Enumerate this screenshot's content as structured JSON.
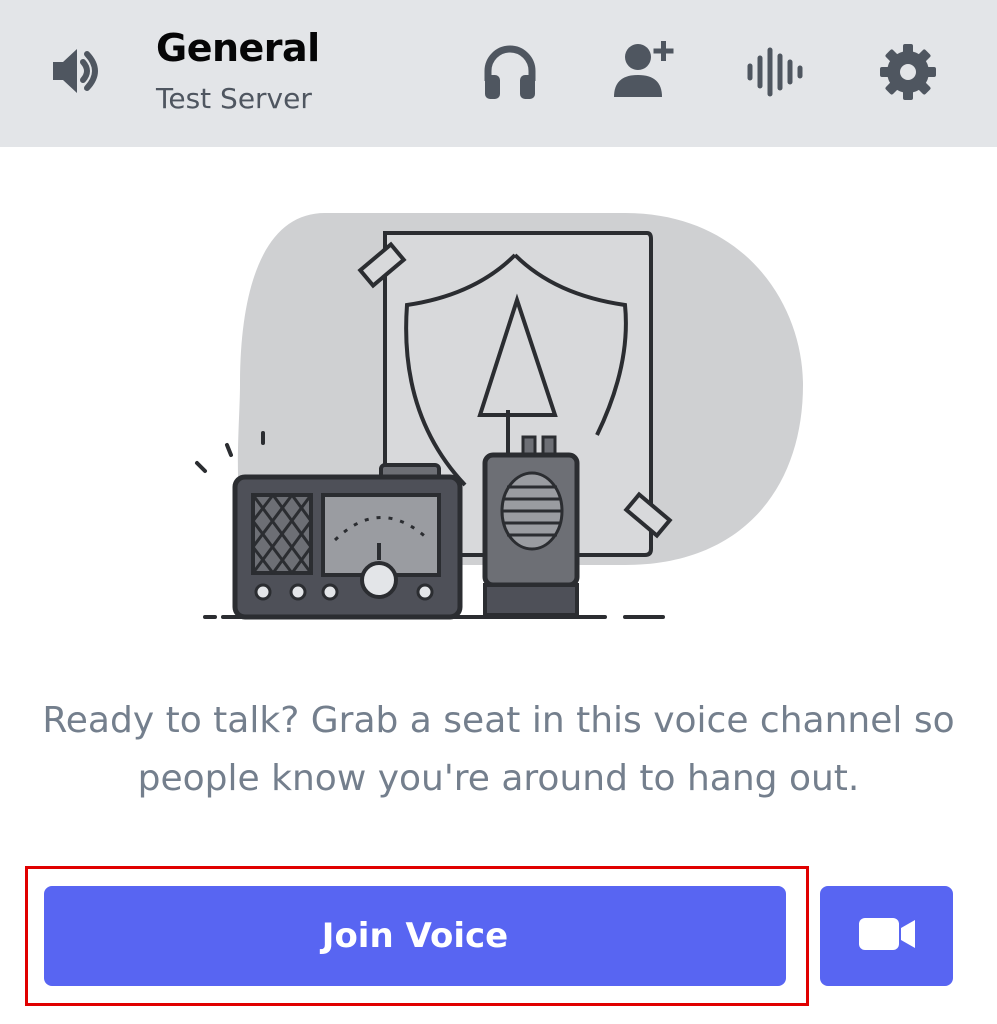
{
  "header": {
    "channel_name": "General",
    "server_name": "Test Server",
    "icons": {
      "speaker": "speaker-icon",
      "headphones": "headphones-icon",
      "add_member": "add-member-icon",
      "activity": "voice-activity-icon",
      "settings": "gear-icon"
    },
    "background_color": "#e3e5e8"
  },
  "main": {
    "illustration": "radio-and-walkie-talkie-illustration",
    "message": "Ready to talk? Grab a seat in this voice channel so people know you're around to hang out."
  },
  "actions": {
    "join_label": "Join Voice",
    "video_icon": "video-camera-icon",
    "accent_color": "#5865f2",
    "highlight_color": "#e00000"
  }
}
